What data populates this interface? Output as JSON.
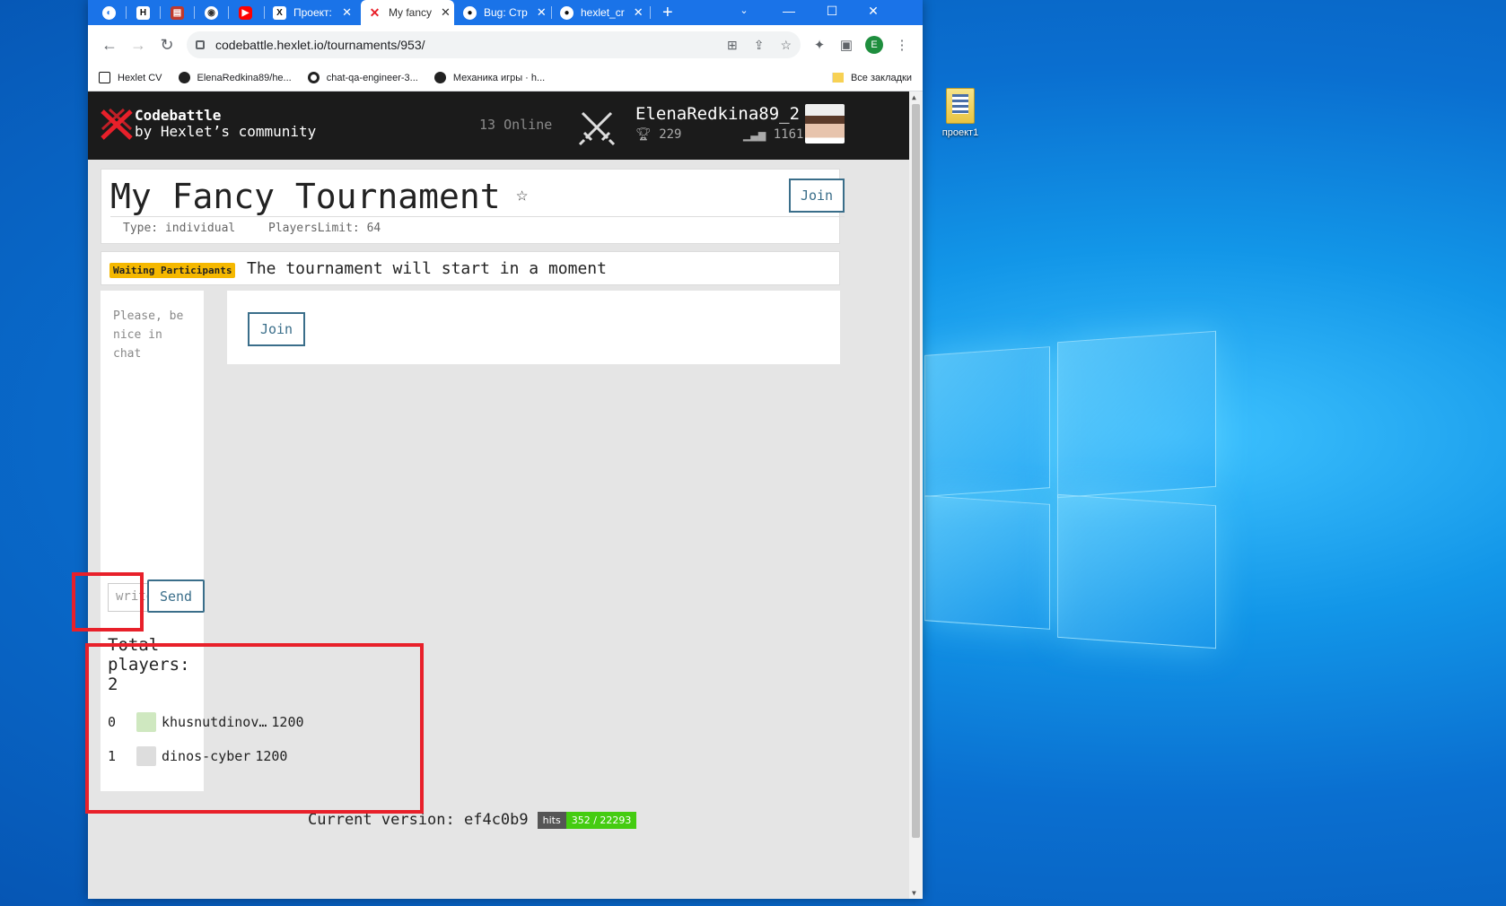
{
  "desktop": {
    "icon_label": "проект1"
  },
  "browser": {
    "tabs": [
      {
        "label": "",
        "icon": "circle-globe-icon"
      },
      {
        "label": "",
        "icon": "hexlet-icon"
      },
      {
        "label": "",
        "icon": "book-icon"
      },
      {
        "label": "",
        "icon": "compass-icon"
      },
      {
        "label": "",
        "icon": "youtube-icon"
      },
      {
        "label": "Проект:",
        "icon": "x-icon"
      },
      {
        "label": "My fancy",
        "icon": "codebattle-icon"
      },
      {
        "label": "Bug: Стр",
        "icon": "github-icon"
      },
      {
        "label": "hexlet_cr",
        "icon": "github-icon"
      }
    ],
    "new_tab": "+",
    "url": "codebattle.hexlet.io/tournaments/953/",
    "profile_initial": "E",
    "bookmarks": [
      {
        "label": "Hexlet CV"
      },
      {
        "label": "ElenaRedkina89/he..."
      },
      {
        "label": "chat-qa-engineer-3..."
      },
      {
        "label": "Механика игры · h..."
      }
    ],
    "all_bookmarks": "Все закладки"
  },
  "header": {
    "brand_line1": "Codebattle",
    "brand_line2": "by Hexlet’s community",
    "online": "13 Online",
    "username": "ElenaRedkina89_2",
    "trophies": "229",
    "rating": "1161"
  },
  "tournament": {
    "title": "My Fancy Tournament",
    "join_label": "Join",
    "type": "Type: individual",
    "players_limit": "PlayersLimit: 64",
    "status_badge": "Waiting Participants",
    "status_text": "The tournament will start in a moment"
  },
  "chat": {
    "hint": "Please, be nice in chat",
    "input_placeholder": "write",
    "send_label": "Send"
  },
  "main_panel": {
    "join_label": "Join"
  },
  "players": {
    "title": "Total players: 2",
    "list": [
      {
        "rank": "0",
        "name": "khusnutdinov…",
        "rating": "1200"
      },
      {
        "rank": "1",
        "name": "dinos-cyber",
        "rating": "1200"
      }
    ]
  },
  "footer": {
    "version": "Current version: ef4c0b9",
    "hits_label": "hits",
    "hits_value": "352 / 22293"
  },
  "colors": {
    "brand_red": "#e8202a",
    "badge": "#f5b800",
    "button_border": "#3a6e8a",
    "chrome_blue": "#1a73e8",
    "annotation": "#e8202a"
  }
}
